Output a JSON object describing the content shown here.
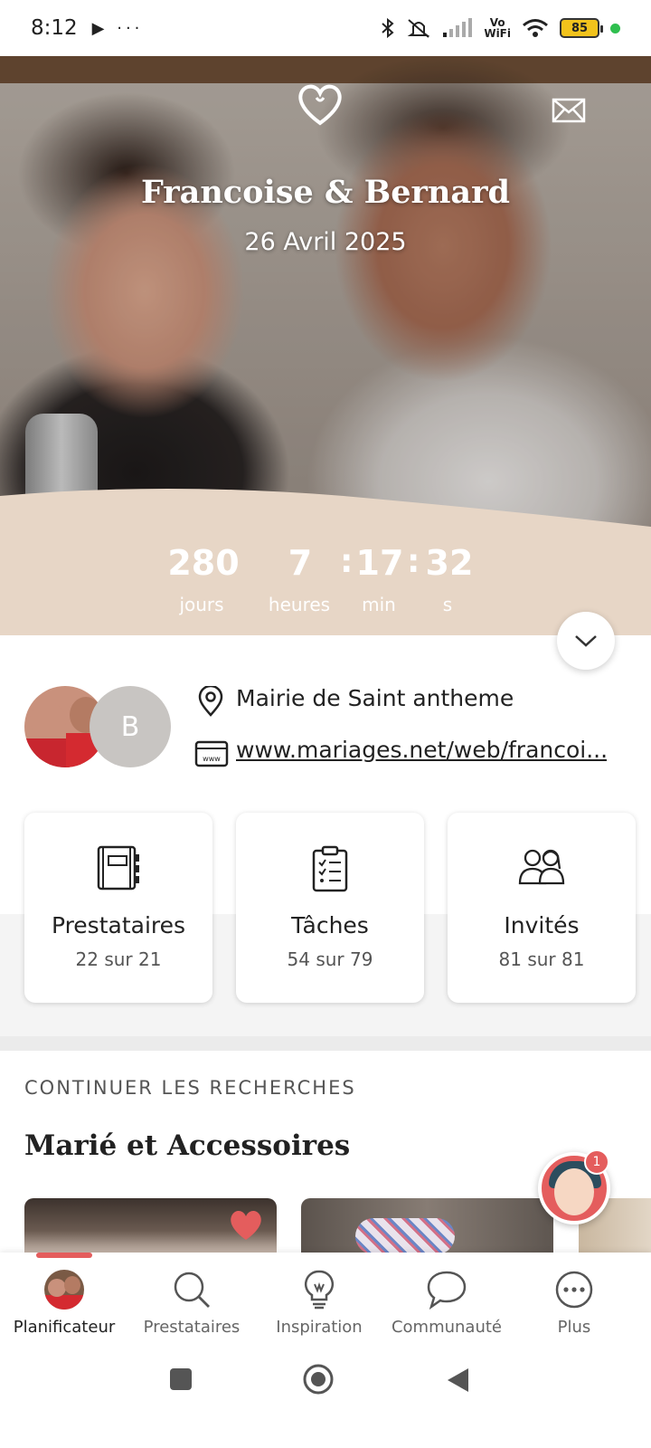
{
  "status_bar": {
    "time": "8:12",
    "left_icons": "▶ ···",
    "network_label_top": "Vo",
    "network_label_bottom": "WiFi",
    "battery_level": "85",
    "icons": [
      "bluetooth-icon",
      "muted-icon",
      "signal-icon",
      "wifi-icon",
      "battery-icon"
    ]
  },
  "hero": {
    "names": "Francoise & Bernard",
    "date": "26 Avril 2025",
    "icons": [
      "heart-icon",
      "mail-icon"
    ]
  },
  "countdown": {
    "days": "280",
    "days_label": "jours",
    "hours": "7",
    "hours_label": "heures",
    "minutes": "17",
    "minutes_label": "min",
    "seconds": "32",
    "seconds_label": "s",
    "separator": ":"
  },
  "profile": {
    "avatar_initial": "B",
    "location": "Mairie de Saint antheme",
    "website": "www.mariages.net/web/francoi..."
  },
  "cards": [
    {
      "title": "Prestataires",
      "count": "22 sur 21",
      "icon": "notebook-icon"
    },
    {
      "title": "Tâches",
      "count": "54 sur 79",
      "icon": "checklist-icon"
    },
    {
      "title": "Invités",
      "count": "81 sur 81",
      "icon": "guests-icon"
    }
  ],
  "continue_section": {
    "label": "CONTINUER LES RECHERCHES",
    "title": "Marié et Accessoires"
  },
  "assistant": {
    "badge_count": "1"
  },
  "bottom_nav": [
    {
      "label": "Planificateur",
      "active": true
    },
    {
      "label": "Prestataires",
      "active": false
    },
    {
      "label": "Inspiration",
      "active": false
    },
    {
      "label": "Communauté",
      "active": false
    },
    {
      "label": "Plus",
      "active": false
    }
  ],
  "colors": {
    "accent": "#e45d5d",
    "countdown_bg": "#e7d6c6",
    "text": "#222222"
  }
}
